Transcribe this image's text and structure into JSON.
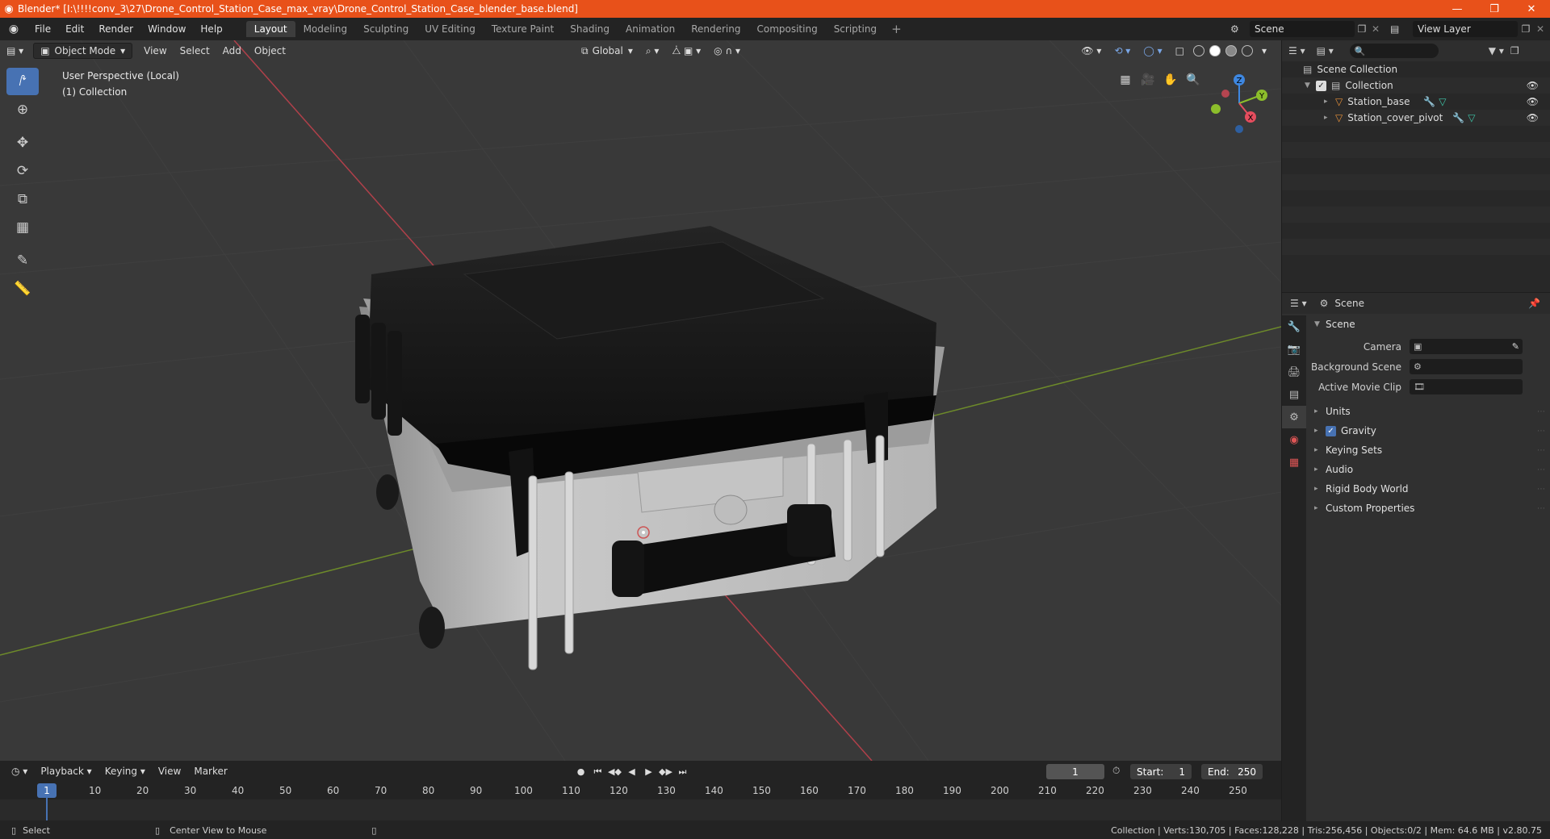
{
  "window": {
    "title": "Blender* [I:\\!!!!conv_3\\27\\Drone_Control_Station_Case_max_vray\\Drone_Control_Station_Case_blender_base.blend]",
    "minimize": "—",
    "maximize": "❐",
    "close": "✕"
  },
  "menu": {
    "file": "File",
    "edit": "Edit",
    "render": "Render",
    "window": "Window",
    "help": "Help"
  },
  "workspaces": [
    "Layout",
    "Modeling",
    "Sculpting",
    "UV Editing",
    "Texture Paint",
    "Shading",
    "Animation",
    "Rendering",
    "Compositing",
    "Scripting"
  ],
  "scene_selector": {
    "value": "Scene"
  },
  "view_layer_selector": {
    "value": "View Layer"
  },
  "viewport": {
    "mode": "Object Mode",
    "menus": {
      "view": "View",
      "select": "Select",
      "add": "Add",
      "object": "Object"
    },
    "orientation": "Global",
    "info_line1": "User Perspective (Local)",
    "info_line2": "(1) Collection",
    "gizmo": {
      "x": "X",
      "y": "Y",
      "z": "Z"
    }
  },
  "timeline": {
    "menus": {
      "playback": "Playback",
      "keying": "Keying",
      "view": "View",
      "marker": "Marker"
    },
    "current_frame": "1",
    "start_label": "Start:",
    "start": "1",
    "end_label": "End:",
    "end": "250",
    "ruler": [
      "1",
      "10",
      "20",
      "30",
      "40",
      "50",
      "60",
      "70",
      "80",
      "90",
      "100",
      "110",
      "120",
      "130",
      "140",
      "150",
      "160",
      "170",
      "180",
      "190",
      "200",
      "210",
      "220",
      "230",
      "240",
      "250"
    ]
  },
  "status": {
    "select": "Select",
    "center_view": "Center View to Mouse",
    "stats": "Collection | Verts:130,705 | Faces:128,228 | Tris:256,456 | Objects:0/2 | Mem: 64.6 MB | v2.80.75"
  },
  "outliner": {
    "scene_collection": "Scene Collection",
    "collection": "Collection",
    "objects": [
      "Station_base",
      "Station_cover_pivot"
    ]
  },
  "properties": {
    "header": "Scene",
    "section": "Scene",
    "camera_label": "Camera",
    "background_scene_label": "Background Scene",
    "active_movie_clip_label": "Active Movie Clip",
    "subsections": [
      "Units",
      "Gravity",
      "Keying Sets",
      "Audio",
      "Rigid Body World",
      "Custom Properties"
    ]
  },
  "colors": {
    "accent": "#4772b3",
    "titlebar": "#e8511a",
    "x_axis": "#e54d5e",
    "y_axis": "#8cbe2b",
    "z_axis": "#3e87e0"
  }
}
